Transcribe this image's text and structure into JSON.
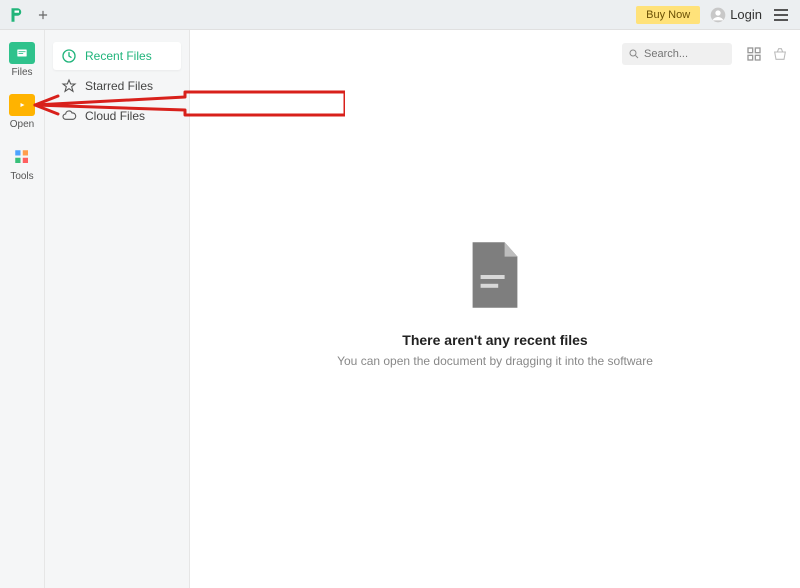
{
  "topbar": {
    "buy_now": "Buy Now",
    "login": "Login"
  },
  "leftbar": {
    "items": [
      {
        "label": "Files"
      },
      {
        "label": "Open"
      },
      {
        "label": "Tools"
      }
    ]
  },
  "sidepanel": {
    "items": [
      {
        "label": "Recent Files"
      },
      {
        "label": "Starred Files"
      },
      {
        "label": "Cloud Files"
      }
    ]
  },
  "search": {
    "placeholder": "Search..."
  },
  "empty_state": {
    "title": "There aren't any recent files",
    "subtitle": "You can open the document by dragging it into the software"
  }
}
